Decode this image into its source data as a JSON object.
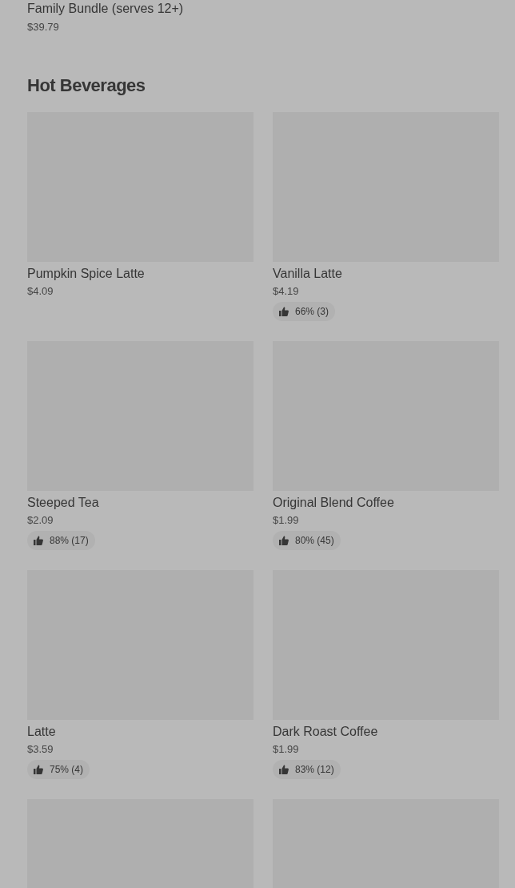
{
  "previous_item": {
    "name": "Family Bundle (serves 12+)",
    "price": "$39.79"
  },
  "section": {
    "title": "Hot Beverages",
    "items": [
      {
        "kind": "product",
        "name": "Pumpkin Spice Latte",
        "price": "$4.09"
      },
      {
        "kind": "product",
        "name": "Vanilla Latte",
        "price": "$4.19",
        "rating": "66% (3)"
      },
      {
        "kind": "product",
        "name": "Steeped Tea",
        "price": "$2.09",
        "rating": "88% (17)"
      },
      {
        "kind": "product",
        "name": "Original Blend Coffee",
        "price": "$1.99",
        "rating": "80% (45)"
      },
      {
        "kind": "product",
        "name": "Latte",
        "price": "$3.59",
        "rating": "75% (4)"
      },
      {
        "kind": "product",
        "name": "Dark Roast Coffee",
        "price": "$1.99",
        "rating": "83% (12)"
      },
      {
        "kind": "image_only"
      },
      {
        "kind": "image_only"
      }
    ]
  }
}
